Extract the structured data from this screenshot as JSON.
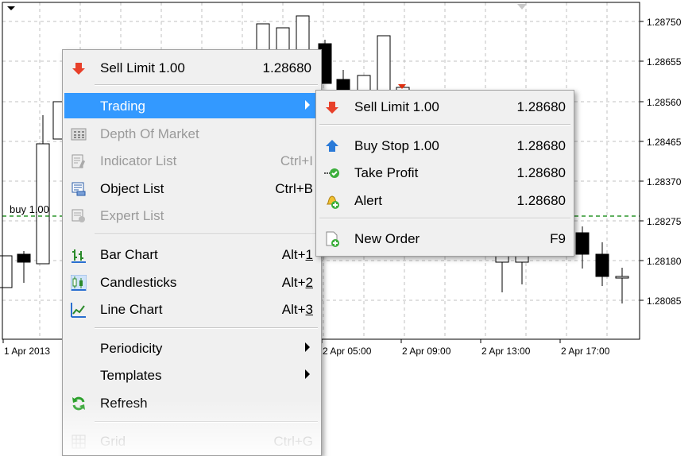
{
  "chart": {
    "price_ticks": [
      "1.28750",
      "1.28655",
      "1.28560",
      "1.28465",
      "1.28370",
      "1.28275",
      "1.28180",
      "1.28085"
    ],
    "time_ticks": [
      "1 Apr 2013",
      "2 Apr 05:00",
      "2 Apr 09:00",
      "2 Apr 13:00",
      "2 Apr 17:00"
    ],
    "order_line_label": "buy 1.00",
    "colors": {
      "grid": "#c0c0c0",
      "order_line": "#008000",
      "candle": "#000000",
      "marker": "#e03010"
    }
  },
  "main_menu": {
    "sell_limit": {
      "label": "Sell Limit 1.00",
      "value": "1.28680"
    },
    "trading": {
      "label": "Trading"
    },
    "depth_of_market": {
      "label": "Depth Of Market"
    },
    "indicator_list": {
      "label": "Indicator List",
      "shortcut": "Ctrl+I"
    },
    "object_list": {
      "label": "Object List",
      "shortcut": "Ctrl+B"
    },
    "expert_list": {
      "label": "Expert List"
    },
    "bar_chart": {
      "label": "Bar Chart",
      "shortcut_prefix": "Alt+",
      "shortcut_key": "1"
    },
    "candlesticks": {
      "label": "Candlesticks",
      "shortcut_prefix": "Alt+",
      "shortcut_key": "2"
    },
    "line_chart": {
      "label": "Line Chart",
      "shortcut_prefix": "Alt+",
      "shortcut_key": "3"
    },
    "periodicity": {
      "label": "Periodicity"
    },
    "templates": {
      "label": "Templates"
    },
    "refresh": {
      "label": "Refresh"
    },
    "grid": {
      "label": "Grid",
      "shortcut": "Ctrl+G"
    },
    "highlight_color": "#3399ff"
  },
  "trading_submenu": {
    "sell_limit": {
      "label": "Sell Limit 1.00",
      "value": "1.28680"
    },
    "buy_stop": {
      "label": "Buy Stop 1.00",
      "value": "1.28680"
    },
    "take_profit": {
      "label": "Take Profit",
      "value": "1.28680"
    },
    "alert": {
      "label": "Alert",
      "value": "1.28680"
    },
    "new_order": {
      "label": "New Order",
      "shortcut": "F9"
    }
  }
}
